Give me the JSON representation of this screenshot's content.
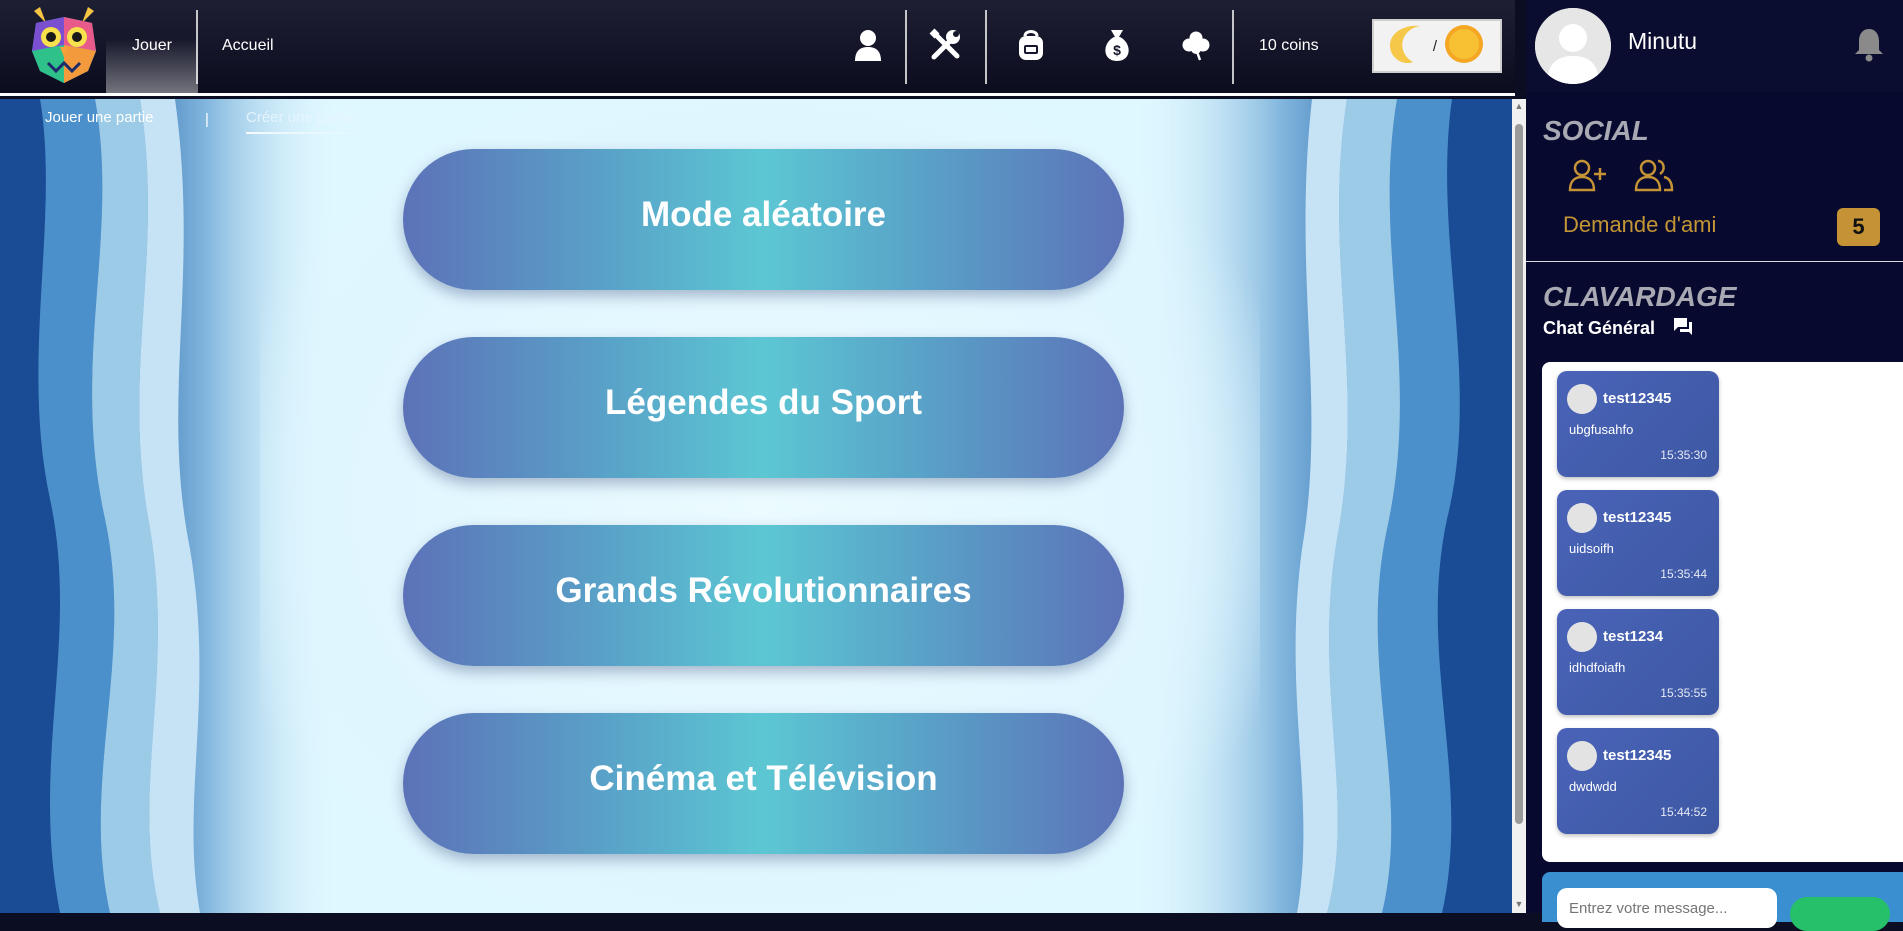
{
  "nav": {
    "jouer": "Jouer",
    "accueil": "Accueil",
    "coins": "10 coins",
    "theme_separator": "/"
  },
  "subtabs": {
    "play": "Jouer une partie",
    "divider": "|",
    "create": "Créer une partie"
  },
  "modes": [
    {
      "label": "Mode aléatoire"
    },
    {
      "label": "Légendes du Sport"
    },
    {
      "label": "Grands Révolutionnaires"
    },
    {
      "label": "Cinéma et Télévision"
    }
  ],
  "profile": {
    "username": "Minutu"
  },
  "social": {
    "title": "SOCIAL",
    "friend_request_label": "Demande d'ami",
    "friend_request_count": "5"
  },
  "chat": {
    "title": "CLAVARDAGE",
    "channel": "Chat Général",
    "input_placeholder": "Entrez votre message...",
    "messages": [
      {
        "user": "test12345",
        "text": "ubgfusahfo",
        "time": "15:35:30"
      },
      {
        "user": "test12345",
        "text": "uidsoifh",
        "time": "15:35:44"
      },
      {
        "user": "test1234",
        "text": "idhdfoiafh",
        "time": "15:35:55"
      },
      {
        "user": "test12345",
        "text": "dwdwdd",
        "time": "15:44:52"
      }
    ]
  },
  "colors": {
    "nav_bg": "#0b0c1e",
    "sidebar_bg": "#070a2e",
    "accent_gold": "#c59335",
    "mode_button_teal": "#5cc7d3",
    "mode_button_blue": "#5c72b8",
    "message_bubble": "#4a63b8",
    "send_green": "#26c06a"
  },
  "icons": {
    "profile": "user-icon",
    "settings": "tools-icon",
    "inventory": "backpack-icon",
    "shop": "money-bag-icon",
    "luck": "clover-icon",
    "theme_dark": "moon-icon",
    "theme_light": "sun-icon",
    "notifications": "bell-icon",
    "add_friend": "user-plus-icon",
    "friends": "users-icon",
    "chat": "chat-bubbles-icon"
  }
}
